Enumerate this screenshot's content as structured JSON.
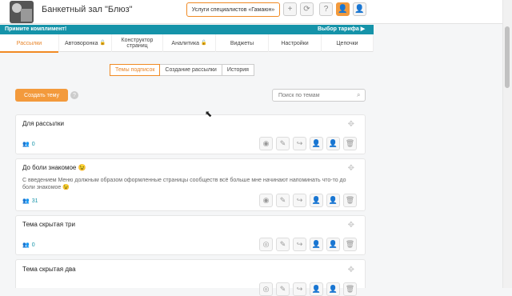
{
  "header": {
    "title": "Банкетный зал \"Блюз\"",
    "specialists_button": "Услуги специалистов «Гамаюн»",
    "icons": [
      "plus-icon",
      "refresh-icon",
      "help-icon",
      "user-orange-icon",
      "user-icon"
    ]
  },
  "banner": {
    "left": "Примите комплимент!",
    "right": "Выбор тарифа ▶"
  },
  "tabs": [
    {
      "label": "Рассылки",
      "active": true,
      "locked": false
    },
    {
      "label": "Автоворонка",
      "active": false,
      "locked": true
    },
    {
      "label": "Конструктор страниц",
      "active": false,
      "locked": false
    },
    {
      "label": "Аналитика",
      "active": false,
      "locked": true
    },
    {
      "label": "Виджеты",
      "active": false,
      "locked": false
    },
    {
      "label": "Настройки",
      "active": false,
      "locked": false
    },
    {
      "label": "Цепочки",
      "active": false,
      "locked": false
    }
  ],
  "subtabs": [
    {
      "label": "Темы подписок",
      "active": true
    },
    {
      "label": "Создание рассылки",
      "active": false
    },
    {
      "label": "История",
      "active": false
    }
  ],
  "toolbar": {
    "create_label": "Создать тему",
    "help": "?",
    "search_placeholder": "Поиск по темам"
  },
  "topics": [
    {
      "title": "Для рассылки",
      "desc": "",
      "count": "0"
    },
    {
      "title": "До боли знакомое 😉",
      "desc": "С введением Меню должным образом оформленные страницы сообществ всё больше мне начинают напоминать что-то до боли знакомое 😉",
      "count": "31"
    },
    {
      "title": "Тема скрытая три",
      "desc": "",
      "count": "0"
    },
    {
      "title": "Тема скрытая два",
      "desc": "",
      "count": ""
    }
  ],
  "accent": "#f08a24",
  "banner_color": "#1593a9"
}
